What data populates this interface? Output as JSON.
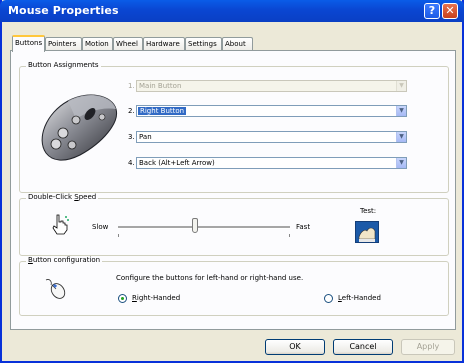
{
  "window": {
    "title": "Mouse Properties",
    "help_glyph": "?",
    "close_glyph": "✕"
  },
  "tabs": [
    "Buttons",
    "Pointers",
    "Motion",
    "Wheel",
    "Hardware",
    "Settings",
    "About"
  ],
  "button_assignments": {
    "legend": "Button Assignments",
    "rows": [
      {
        "number": "1.",
        "value": "Main Button",
        "state": "disabled"
      },
      {
        "number": "2.",
        "value": "Right Button",
        "state": "selected"
      },
      {
        "number": "3.",
        "value": "Pan",
        "state": "normal"
      },
      {
        "number": "4.",
        "value": "Back (Alt+Left Arrow)",
        "state": "normal"
      }
    ]
  },
  "double_click": {
    "legend": "Double-Click Speed",
    "slow": "Slow",
    "fast": "Fast",
    "test": "Test:",
    "slider_fraction": 0.45
  },
  "button_config": {
    "legend": "Button configuration",
    "description": "Configure the buttons for left-hand or right-hand use.",
    "right_handed": "Right-Handed",
    "left_handed": "Left-Handed",
    "selected": "right"
  },
  "footer": {
    "ok": "OK",
    "cancel": "Cancel",
    "apply": "Apply"
  }
}
